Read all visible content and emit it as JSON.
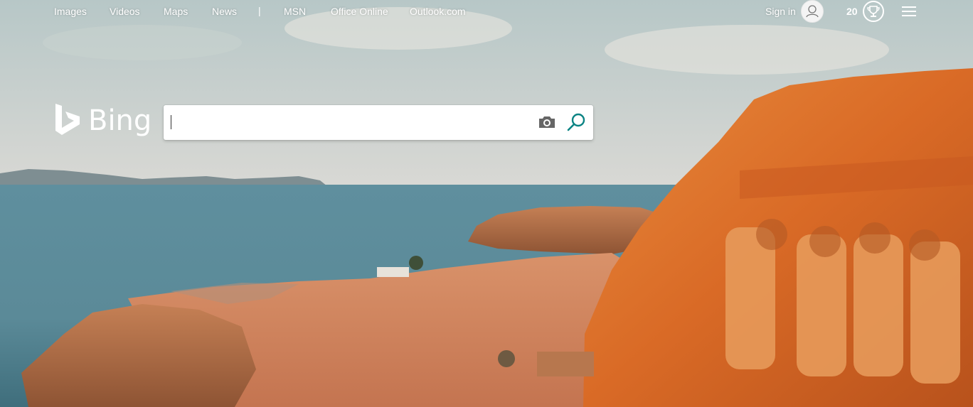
{
  "nav": {
    "links": [
      "Images",
      "Videos",
      "Maps",
      "News",
      "MSN",
      "Office Online",
      "Outlook.com"
    ],
    "separator": "|"
  },
  "account": {
    "signin_label": "Sign in",
    "rewards_count": "20"
  },
  "logo": {
    "text": "Bing"
  },
  "search": {
    "value": "",
    "placeholder": ""
  },
  "icons": {
    "avatar": "person-icon",
    "rewards": "trophy-icon",
    "menu": "hamburger-menu-icon",
    "camera": "camera-icon",
    "search": "search-icon"
  },
  "colors": {
    "search_icon": "#0c8484",
    "camera_icon": "#666666",
    "text": "#ffffff"
  }
}
